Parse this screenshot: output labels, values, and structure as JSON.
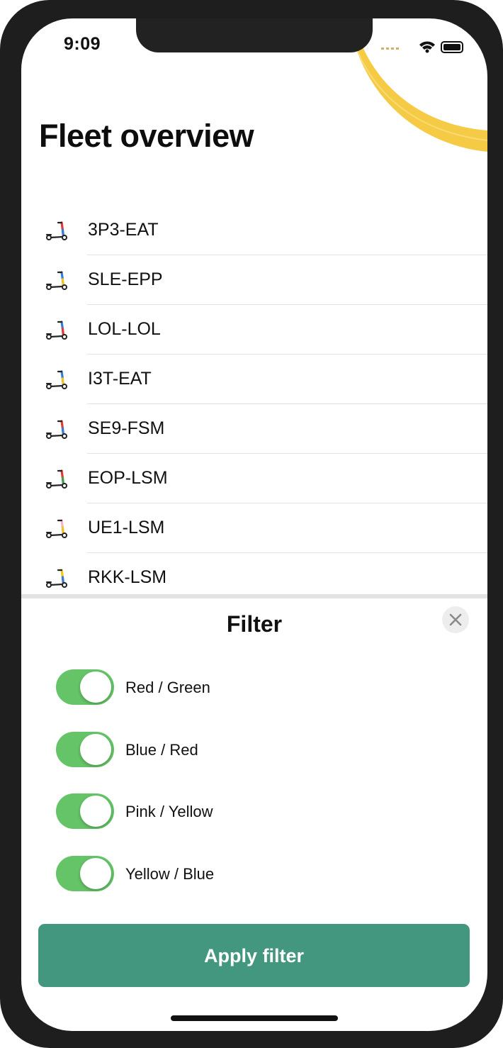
{
  "status_bar": {
    "time": "9:09"
  },
  "page": {
    "title": "Fleet overview"
  },
  "fleet": [
    {
      "id": "3P3-EAT",
      "colors": [
        "#e53935",
        "#3a7bd5"
      ]
    },
    {
      "id": "SLE-EPP",
      "colors": [
        "#3a7bd5",
        "#f3c623"
      ]
    },
    {
      "id": "LOL-LOL",
      "colors": [
        "#3a7bd5",
        "#e53935"
      ]
    },
    {
      "id": "I3T-EAT",
      "colors": [
        "#3a7bd5",
        "#f3c623"
      ]
    },
    {
      "id": "SE9-FSM",
      "colors": [
        "#e53935",
        "#3a7bd5"
      ]
    },
    {
      "id": "EOP-LSM",
      "colors": [
        "#e53935",
        "#43a047"
      ]
    },
    {
      "id": "UE1-LSM",
      "colors": [
        "#f7b6c8",
        "#f3c623"
      ]
    },
    {
      "id": "RKK-LSM",
      "colors": [
        "#f3c623",
        "#3a7bd5"
      ]
    }
  ],
  "filter": {
    "title": "Filter",
    "close_icon": "close-icon",
    "options": [
      {
        "label": "Red / Green",
        "enabled": true
      },
      {
        "label": "Blue / Red",
        "enabled": true
      },
      {
        "label": "Pink / Yellow",
        "enabled": true
      },
      {
        "label": "Yellow / Blue",
        "enabled": true
      }
    ],
    "apply_label": "Apply filter"
  },
  "colors": {
    "accent_yellow": "#f5cb45",
    "toggle_on": "#64c467",
    "apply_button": "#43977f"
  }
}
